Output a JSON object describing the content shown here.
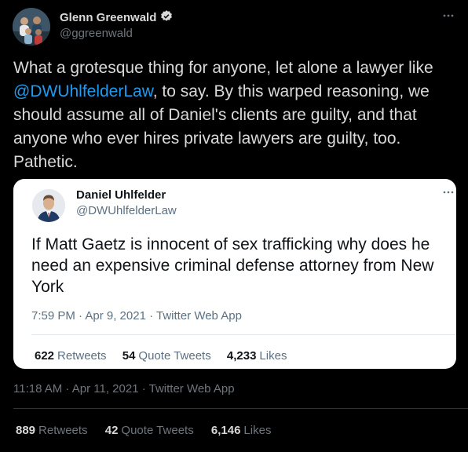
{
  "author": {
    "name": "Glenn Greenwald",
    "handle": "@ggreenwald"
  },
  "tweet": {
    "text_before": "What a grotesque thing for anyone, let alone a lawyer like ",
    "mention": "@DWUhlfelderLaw",
    "text_after": ", to say. By this warped reasoning, we should assume all of Daniel's clients are guilty, and that anyone who ever hires private lawyers are guilty, too. Pathetic.",
    "timestamp": "11:18 AM · Apr 11, 2021 · Twitter Web App",
    "stats": {
      "retweets_count": "889",
      "retweets_label": "Retweets",
      "quotes_count": "42",
      "quotes_label": "Quote Tweets",
      "likes_count": "6,146",
      "likes_label": "Likes"
    }
  },
  "quoted_tweet": {
    "name": "Daniel Uhlfelder",
    "handle": "@DWUhlfelderLaw",
    "text": "If Matt Gaetz is innocent of sex trafficking why does he need an expensive criminal defense attorney from New York",
    "timestamp": "7:59 PM · Apr 9, 2021 · Twitter Web App",
    "stats": {
      "retweets_count": "622",
      "retweets_label": "Retweets",
      "quotes_count": "54",
      "quotes_label": "Quote Tweets",
      "likes_count": "4,233",
      "likes_label": "Likes"
    }
  },
  "icons": {
    "more": "more-icon",
    "verified": "verified-badge-icon"
  },
  "colors": {
    "background": "#000000",
    "accent": "#1d9bf0",
    "text_primary": "#d9d9d9",
    "text_secondary": "#6e767d",
    "card_bg": "#ffffff"
  }
}
